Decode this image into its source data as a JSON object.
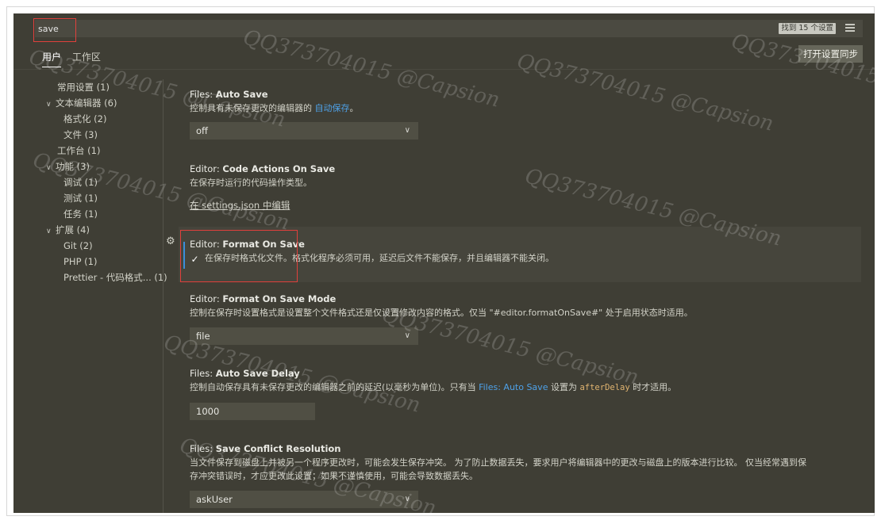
{
  "search": {
    "value": "save",
    "found_label": "找到 15 个设置"
  },
  "tabs": [
    {
      "label": "用户"
    },
    {
      "label": "工作区"
    }
  ],
  "sync_button": "打开设置同步",
  "tree": [
    {
      "label": "常用设置 (1)"
    },
    {
      "label": "文本编辑器 (6)",
      "chevron": "∨"
    },
    {
      "label": "格式化 (2)"
    },
    {
      "label": "文件 (3)"
    },
    {
      "label": "工作台 (1)"
    },
    {
      "label": "功能 (3)",
      "chevron": "∨"
    },
    {
      "label": "调试 (1)"
    },
    {
      "label": "测试 (1)"
    },
    {
      "label": "任务 (1)"
    },
    {
      "label": "扩展 (4)",
      "chevron": "∨"
    },
    {
      "label": "Git (2)"
    },
    {
      "label": "PHP (1)"
    },
    {
      "label": "Prettier - 代码格式...  (1)"
    }
  ],
  "settings": {
    "auto_save": {
      "category": "Files: ",
      "name": "Auto Save",
      "desc_prefix": "控制具有未保存更改的编辑器的 ",
      "desc_link": "自动保存",
      "desc_suffix": "。",
      "value": "off"
    },
    "code_actions": {
      "category": "Editor: ",
      "name": "Code Actions On Save",
      "desc": "在保存时运行的代码操作类型。",
      "edit_link": "在 settings.json 中编辑"
    },
    "format_on_save": {
      "category": "Editor: ",
      "name": "Format On Save",
      "checked": true,
      "check_glyph": "✓",
      "desc": "在保存时格式化文件。格式化程序必须可用，延迟后文件不能保存，并且编辑器不能关闭。"
    },
    "format_on_save_mode": {
      "category": "Editor: ",
      "name": "Format On Save Mode",
      "desc": "控制在保存时设置格式是设置整个文件格式还是仅设置修改内容的格式。仅当 \"#editor.formatOnSave#\" 处于启用状态时适用。",
      "value": "file"
    },
    "auto_save_delay": {
      "category": "Files: ",
      "name": "Auto Save Delay",
      "desc_prefix": "控制自动保存具有未保存更改的编辑器之前的延迟(以毫秒为单位)。只有当 ",
      "desc_link": "Files: Auto Save",
      "desc_mid": " 设置为 ",
      "desc_code": "afterDelay",
      "desc_suffix": " 时才适用。",
      "value": "1000"
    },
    "save_conflict": {
      "category": "Files: ",
      "name": "Save Conflict Resolution",
      "desc_line1": "当文件保存到磁盘上并被另一个程序更改时，可能会发生保存冲突。 为了防止数据丢失，要求用户将编辑器中的更改与磁盘上的版本进行比较。 仅当经常遇到保",
      "desc_line2": "存冲突错误时，才应更改此设置；如果不谨慎使用，可能会导致数据丢失。",
      "value": "askUser"
    }
  },
  "watermark": "QQ373704015 @Capsion",
  "accent_link_color": "#4ea1e8",
  "highlight_box_color": "#e0403c"
}
